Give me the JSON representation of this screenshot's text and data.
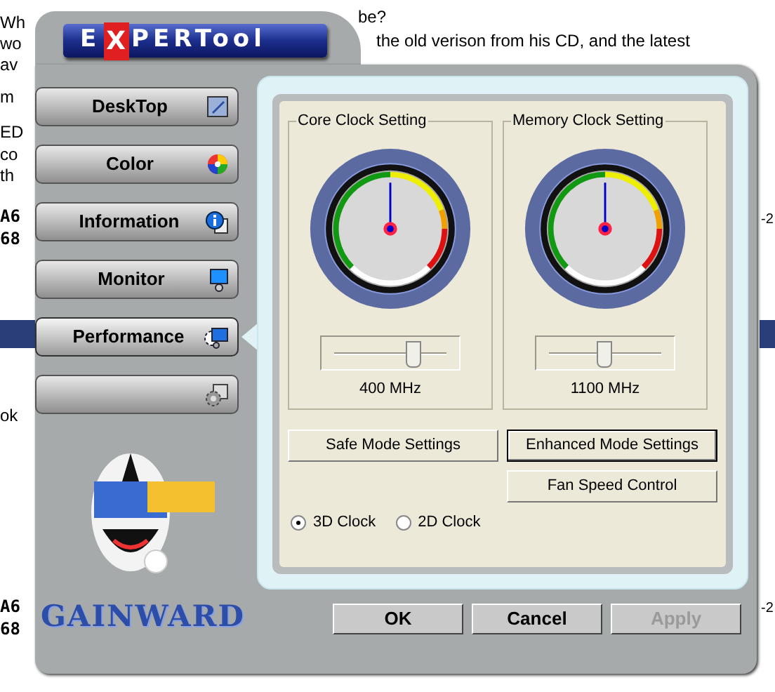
{
  "background_page": {
    "fragments": [
      {
        "text": "Wh",
        "kind": "text"
      },
      {
        "text": "be?",
        "kind": "text"
      },
      {
        "text": "wo",
        "kind": "text"
      },
      {
        "text": "the old verison from his CD, and the latest",
        "kind": "text"
      },
      {
        "text": "av",
        "kind": "text"
      },
      {
        "text": "m",
        "kind": "text"
      },
      {
        "text": "ED",
        "kind": "text"
      },
      {
        "text": "co",
        "kind": "text"
      },
      {
        "text": "th",
        "kind": "text"
      },
      {
        "text": "A6",
        "kind": "code"
      },
      {
        "text": "68",
        "kind": "code"
      },
      {
        "text": "ok",
        "kind": "text"
      },
      {
        "text": "A6",
        "kind": "code"
      },
      {
        "text": "68",
        "kind": "code"
      },
      {
        "text": "-2",
        "kind": "text"
      },
      {
        "text": "-2",
        "kind": "text"
      }
    ]
  },
  "logo": {
    "before": "E",
    "mark": "X",
    "after": "PERTool"
  },
  "nav": [
    {
      "label": "DeskTop",
      "selected": false
    },
    {
      "label": "Color",
      "selected": false
    },
    {
      "label": "Information",
      "selected": false
    },
    {
      "label": "Monitor",
      "selected": false
    },
    {
      "label": "Performance",
      "selected": true
    },
    {
      "selected": false
    }
  ],
  "brand": "GAINWARD",
  "clock_groups": [
    {
      "title": "Core Clock Setting",
      "level": 0.7,
      "reading": "400 MHz"
    },
    {
      "title": "Memory Clock Setting",
      "level": 0.49,
      "reading": "1100 MHz"
    }
  ],
  "mode_buttons": [
    {
      "label": "Safe Mode Settings",
      "focused": false
    },
    {
      "label": "Enhanced Mode Settings",
      "focused": true
    },
    {
      "label": "Fan Speed Control",
      "focused": false
    }
  ],
  "clock_radios": [
    {
      "label": "3D Clock",
      "selected": true
    },
    {
      "label": "2D Clock",
      "selected": false
    }
  ],
  "buttons": [
    {
      "label": "OK",
      "disabled": false
    },
    {
      "label": "Cancel",
      "disabled": false
    },
    {
      "label": "Apply",
      "disabled": true
    }
  ]
}
